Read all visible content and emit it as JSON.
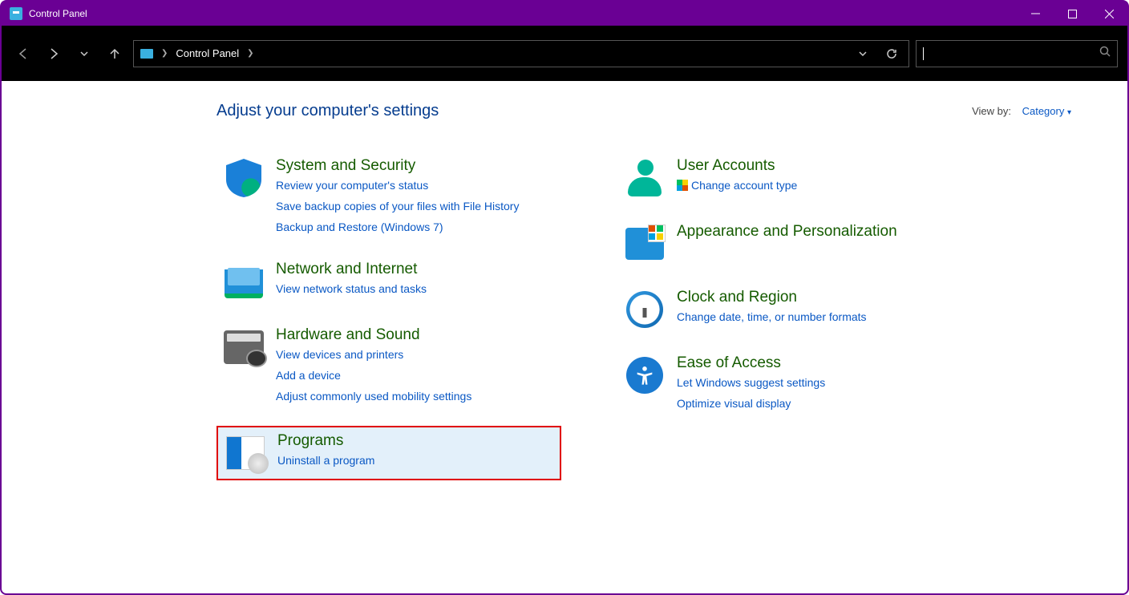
{
  "window": {
    "title": "Control Panel"
  },
  "breadcrumb": {
    "root": "Control Panel"
  },
  "page": {
    "heading": "Adjust your computer's settings",
    "viewby_label": "View by:",
    "viewby_value": "Category"
  },
  "left": {
    "security": {
      "title": "System and Security",
      "links": [
        "Review your computer's status",
        "Save backup copies of your files with File History",
        "Backup and Restore (Windows 7)"
      ]
    },
    "network": {
      "title": "Network and Internet",
      "links": [
        "View network status and tasks"
      ]
    },
    "hardware": {
      "title": "Hardware and Sound",
      "links": [
        "View devices and printers",
        "Add a device",
        "Adjust commonly used mobility settings"
      ]
    },
    "programs": {
      "title": "Programs",
      "links": [
        "Uninstall a program"
      ]
    }
  },
  "right": {
    "users": {
      "title": "User Accounts",
      "links": [
        "Change account type"
      ]
    },
    "appearance": {
      "title": "Appearance and Personalization",
      "links": []
    },
    "clock": {
      "title": "Clock and Region",
      "links": [
        "Change date, time, or number formats"
      ]
    },
    "ease": {
      "title": "Ease of Access",
      "links": [
        "Let Windows suggest settings",
        "Optimize visual display"
      ]
    }
  }
}
